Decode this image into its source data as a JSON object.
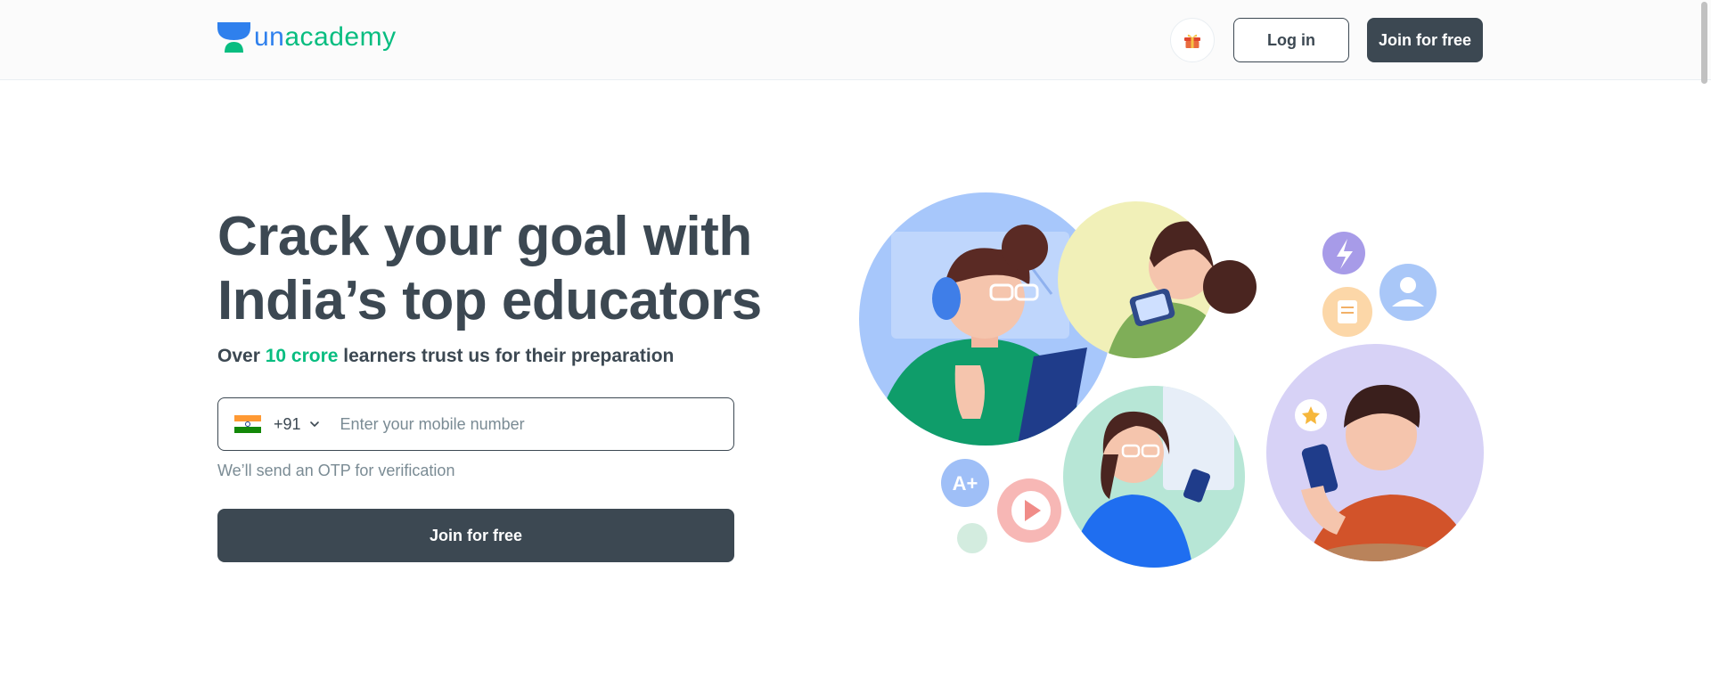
{
  "header": {
    "brand": {
      "part1": "un",
      "part2": "academy"
    },
    "gift_icon": "gift-icon",
    "login_label": "Log in",
    "join_label": "Join for free"
  },
  "hero": {
    "title_line1": "Crack your goal with",
    "title_line2": "India’s top educators",
    "subtitle_pre": "Over ",
    "subtitle_highlight": "10 crore",
    "subtitle_post": " learners trust us for their preparation",
    "phone": {
      "country_flag": "india-flag-icon",
      "country_code": "+91",
      "placeholder": "Enter your mobile number",
      "value": ""
    },
    "otp_note": "We’ll send an OTP for verification",
    "join_label": "Join for free"
  },
  "illustration": {
    "badges": {
      "grade": "A+"
    }
  },
  "colors": {
    "primary_dark": "#3c4852",
    "accent_green": "#08bd80",
    "brand_blue": "#2f80ed",
    "muted_text": "#7a8b94"
  }
}
